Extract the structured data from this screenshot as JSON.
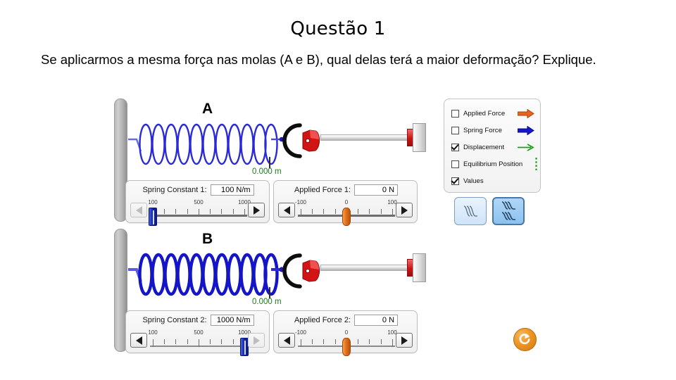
{
  "slide": {
    "title": "Questão 1",
    "question": "Se aplicarmos a mesma força nas molas (A e B), qual delas terá a maior deformação? Explique."
  },
  "simulation": {
    "springs": [
      {
        "label": "A",
        "displacement": "0.000 m",
        "spring_constant": {
          "label": "Spring Constant 1:",
          "value": "100 N/m",
          "ticks": [
            "100",
            "500",
            "1000"
          ],
          "knob_percent": 0,
          "left_button_enabled": false,
          "right_button_enabled": true
        },
        "applied_force": {
          "label": "Applied Force 1:",
          "value": "0 N",
          "ticks": [
            "-100",
            "0",
            "100"
          ],
          "knob_percent": 50,
          "left_button_enabled": true,
          "right_button_enabled": true
        }
      },
      {
        "label": "B",
        "displacement": "0.000 m",
        "spring_constant": {
          "label": "Spring Constant 2:",
          "value": "1000 N/m",
          "ticks": [
            "100",
            "500",
            "1000"
          ],
          "knob_percent": 100,
          "left_button_enabled": true,
          "right_button_enabled": false
        },
        "applied_force": {
          "label": "Applied Force 2:",
          "value": "0 N",
          "ticks": [
            "-100",
            "0",
            "100"
          ],
          "knob_percent": 50,
          "left_button_enabled": true,
          "right_button_enabled": true
        }
      }
    ],
    "checkbox_panel": {
      "items": [
        {
          "label": "Applied Force",
          "checked": false,
          "icon": "orange-arrow-icon"
        },
        {
          "label": "Spring Force",
          "checked": false,
          "icon": "blue-arrow-icon"
        },
        {
          "label": "Displacement",
          "checked": true,
          "icon": "green-arrow-icon"
        },
        {
          "label": "Equilibrium Position",
          "checked": false,
          "icon": "green-dotted-line-icon"
        },
        {
          "label": "Values",
          "checked": true,
          "icon": ""
        }
      ]
    },
    "mode_buttons": [
      {
        "name": "single-spring-mode",
        "selected": false
      },
      {
        "name": "two-spring-mode",
        "selected": true
      }
    ],
    "reset_button": {
      "name": "reset-all-button"
    },
    "colors": {
      "applied_force_arrow": "#e8651c",
      "spring_force_arrow": "#1616c8",
      "displacement_arrow": "#19a219",
      "equilibrium_line": "#19a219",
      "displacement_text": "#1d7a1d",
      "spring_coil": "#1414c8",
      "spring_a_coil": "#2a2ad6",
      "clamp_red": "#d31414",
      "reset_orange": "#ed9526"
    }
  }
}
